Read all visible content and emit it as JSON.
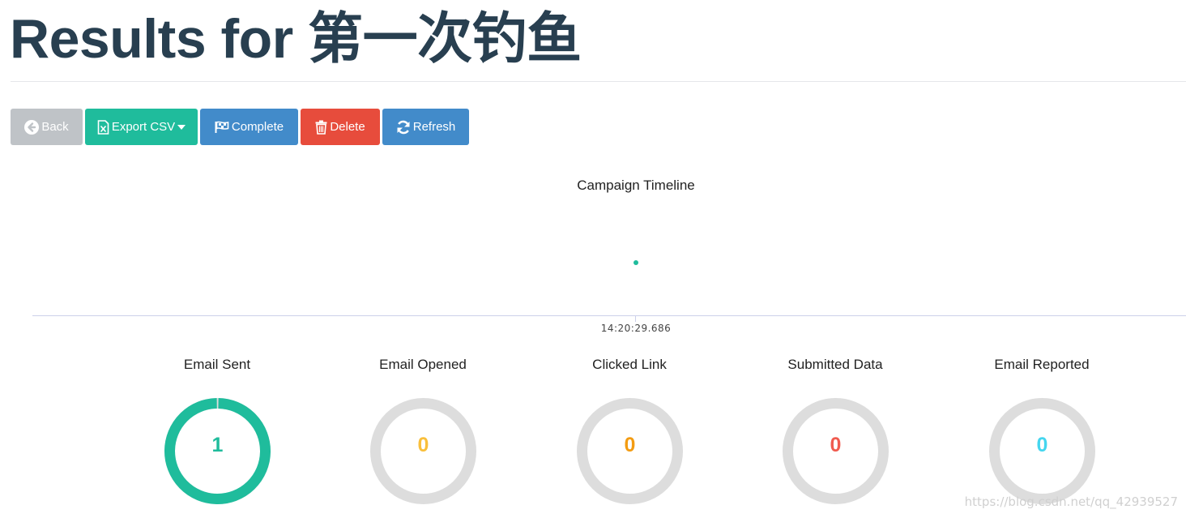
{
  "header": {
    "title": "Results for 第一次钓鱼"
  },
  "toolbar": {
    "back_label": "Back",
    "export_label": "Export CSV",
    "complete_label": "Complete",
    "delete_label": "Delete",
    "refresh_label": "Refresh"
  },
  "timeline": {
    "title": "Campaign Timeline",
    "event_time": "14:20:29.686",
    "dot_color": "#1fbc9c"
  },
  "stats": [
    {
      "label": "Email Sent",
      "value": "1",
      "fraction": 1,
      "color": "#1fbc9c"
    },
    {
      "label": "Email Opened",
      "value": "0",
      "fraction": 0,
      "color": "#f9bf3b"
    },
    {
      "label": "Clicked Link",
      "value": "0",
      "fraction": 0,
      "color": "#f39c12"
    },
    {
      "label": "Submitted Data",
      "value": "0",
      "fraction": 0,
      "color": "#f05b4f"
    },
    {
      "label": "Email Reported",
      "value": "0",
      "fraction": 0,
      "color": "#45d6ef"
    }
  ],
  "colors": {
    "ring_track": "#dddddd",
    "back": "#bfc3c7",
    "export": "#1fbc9c",
    "primary": "#428bca",
    "danger": "#e74c3c"
  },
  "watermark": "https://blog.csdn.net/qq_42939527"
}
